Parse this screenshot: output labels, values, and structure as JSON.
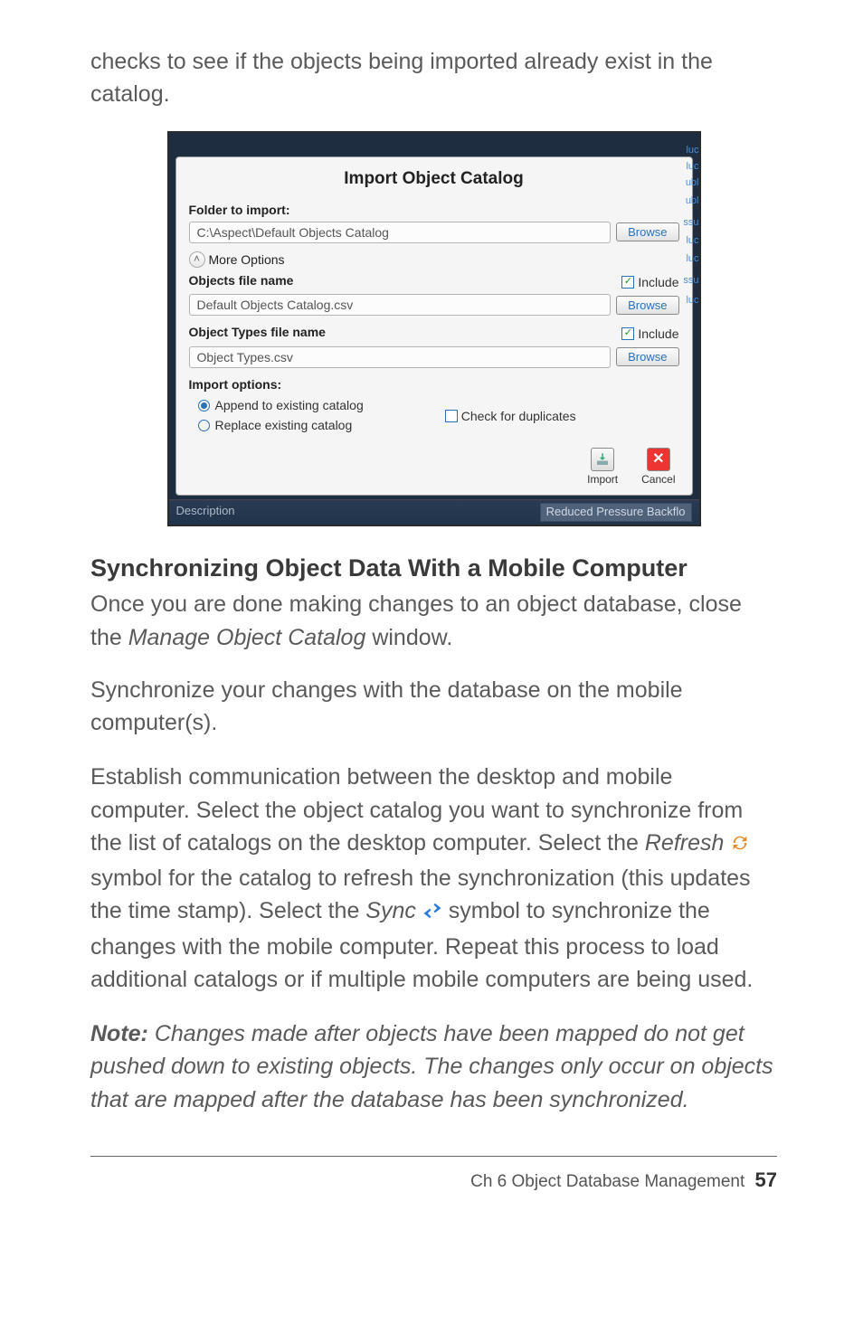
{
  "intro": "checks to see if the objects being imported already exist in the catalog.",
  "dialog": {
    "title": "Import Object Catalog",
    "folder_label": "Folder to import:",
    "folder_value": "C:\\Aspect\\Default Objects Catalog",
    "browse": "Browse",
    "more_options": "More Options",
    "objects_file_label": "Objects file name",
    "objects_file_value": "Default Objects Catalog.csv",
    "include": "Include",
    "types_file_label": "Object Types file name",
    "types_file_value": "Object Types.csv",
    "import_options_label": "Import options:",
    "opt_append": "Append to existing catalog",
    "opt_replace": "Replace existing catalog",
    "check_dup": "Check for duplicates",
    "import_btn": "Import",
    "cancel_btn": "Cancel",
    "desc_left": "Description",
    "desc_right": "Reduced Pressure Backflo"
  },
  "section_heading": "Synchronizing Object Data With a Mobile Computer",
  "p1a": "Once you are done making changes to an object database, close the ",
  "p1b": "Manage Object Catalog",
  "p1c": " window.",
  "p2": "Synchronize your changes with the database on the mobile computer(s).",
  "p3a": "Establish communication between the desktop and mobile computer. Select the object catalog you want to synchronize from the list of catalogs on the desktop computer. Select the ",
  "p3b": "Refresh",
  "p3c": " symbol for the catalog to refresh the synchronization (this updates the time stamp). Select the ",
  "p3d": "Sync",
  "p3e": " symbol to synchronize the changes with the mobile computer. Repeat this process to load additional catalogs or if multiple mobile computers are being used.",
  "note_label": "Note:",
  "note_body": " Changes made after objects have been mapped do not get pushed down to existing objects. The changes only occur on objects that are mapped after the database has been synchronized.",
  "footer_chapter": "Ch 6   Object Database Management",
  "footer_page": "57"
}
